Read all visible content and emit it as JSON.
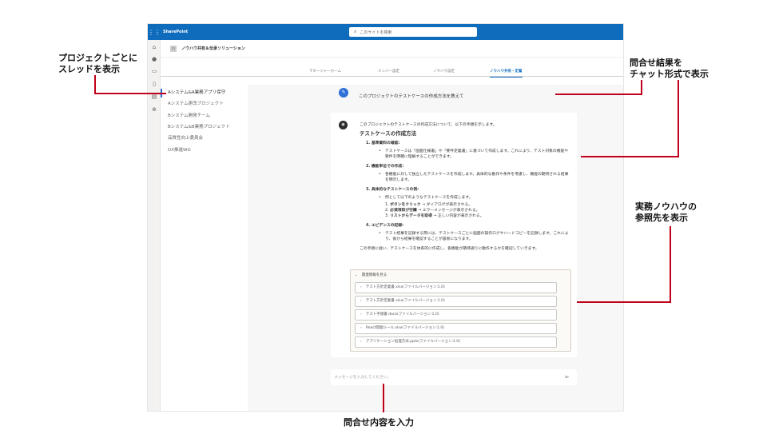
{
  "header": {
    "app_name": "SharePoint",
    "search_placeholder": "このサイトを検索"
  },
  "site": {
    "logo_label": "ロ",
    "title": "ノウハウ共有＆伝承ソリューション"
  },
  "tabs": [
    {
      "label": "マネージャーホーム",
      "active": false
    },
    {
      "label": "メンバー設定",
      "active": false
    },
    {
      "label": "ノウハウ設定",
      "active": false
    },
    {
      "label": "ノウハウ共有・定着",
      "active": true
    }
  ],
  "threads": [
    {
      "label": "Aシステム&A業務アプリ保守",
      "selected": true
    },
    {
      "label": "Aシステム更改プロジェクト",
      "selected": false
    },
    {
      "label": "Bシステム開発チーム",
      "selected": false
    },
    {
      "label": "Bシステム&B業務プロジェクト",
      "selected": false
    },
    {
      "label": "品質性向上委員会",
      "selected": false
    },
    {
      "label": "DX推進WG",
      "selected": false
    }
  ],
  "chat": {
    "question": "このプロジェクトのテストケースの作成方法を教えて",
    "answer": {
      "intro": "このプロジェクトのテストケースの作成方法について、以下の手順を示します。",
      "heading": "テストケースの作成方法",
      "steps": [
        {
          "title": "1. 基準資料の確認:",
          "bullet": "テストケースは「画面仕様書」や「要件定義書」に基づいて作成します。これにより、テスト対象の機能や要件を明確に理解することができます。"
        },
        {
          "title": "2. 機能単位での作成:",
          "bullet": "各機能に対して独立したテストケースを作成します。具体的な動作や条件を考慮し、機能の期待される結果を明示します。"
        },
        {
          "title": "3. 具体的なテストケースの例:",
          "bullet": "例として以下のようなテストケースを作成します。",
          "subs": [
            {
              "num": "1.",
              "bold": "ボタンをクリック",
              "rest": " → ダイアログが表示される。"
            },
            {
              "num": "2.",
              "bold": "必須項目が空欄",
              "rest": " → エラーメッセージが表示される。"
            },
            {
              "num": "3.",
              "bold": "リストからデータを取得",
              "rest": " → 正しい内容が表示される。"
            }
          ]
        },
        {
          "title": "4. エビデンスの記録:",
          "bullet": "テスト結果を記録する際には、テストケースごとに画面の操作ログやハードコピーを記録します。これにより、後から結果を確認することが容易になります。"
        }
      ],
      "conclusion": "この手順に従い、テストケースを体系的に作成し、各機能が期待通りに動作するかを確認していきます。"
    },
    "references": {
      "title": "関連情報を見る",
      "items": [
        "テスト方針定義書.xlsx(ファイルバージョン:1.0)",
        "テスト方針定義書.xlsx(ファイルバージョン:1.0)",
        "テスト手順書.docx(ファイルバージョン:1.0)",
        "React開発ルール.xlsx(ファイルバージョン:1.0)",
        "アプリケーション処理方式.pptx(ファイルバージョン:1.0)"
      ]
    },
    "input_placeholder": "メッセージを入力してください。"
  },
  "annotations": {
    "thread_note": [
      "プロジェクトごとに",
      "スレッドを表示"
    ],
    "chat_note": [
      "問合せ結果を",
      "チャット形式で表示"
    ],
    "reference_note": [
      "実務ノウハウの",
      "参照先を表示"
    ],
    "input_note": "問合せ内容を入力"
  },
  "colors": {
    "suite_bar": "#0f6cbd",
    "active_tab": "#0f6cbd",
    "annotation_line": "#c0001a"
  }
}
